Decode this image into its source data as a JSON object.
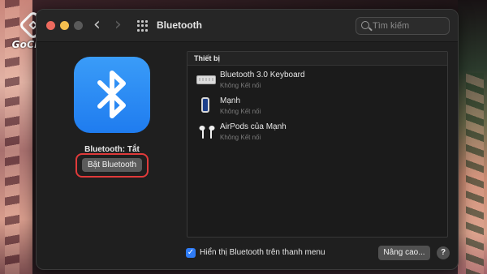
{
  "branding": {
    "logo_text": "GoChek"
  },
  "window": {
    "title": "Bluetooth"
  },
  "toolbar": {
    "back_icon": "chevron-left-icon",
    "forward_icon": "chevron-right-icon",
    "grid_icon": "grid-icon"
  },
  "search": {
    "placeholder": "Tìm kiếm",
    "icon": "search-icon"
  },
  "bluetooth": {
    "icon": "bluetooth-icon",
    "status_text": "Bluetooth: Tắt",
    "toggle_button_label": "Bật Bluetooth"
  },
  "devices": {
    "header": "Thiết bị",
    "items": [
      {
        "name": "Bluetooth 3.0 Keyboard",
        "status": "Không Kết nối",
        "icon": "keyboard-icon"
      },
      {
        "name": "Mạnh",
        "status": "Không Kết nối",
        "icon": "iphone-icon"
      },
      {
        "name": "AirPods của Mạnh",
        "status": "Không Kết nối",
        "icon": "airpods-icon"
      }
    ]
  },
  "footer": {
    "show_in_menu_label": "Hiển thị Bluetooth trên thanh menu",
    "show_in_menu_checked": true,
    "advanced_button_label": "Nâng cao...",
    "help_button_label": "?"
  },
  "colors": {
    "accent": "#2f7cf6",
    "bluetooth_icon_bg": "#1f7cef",
    "highlight": "#e03a3a"
  }
}
